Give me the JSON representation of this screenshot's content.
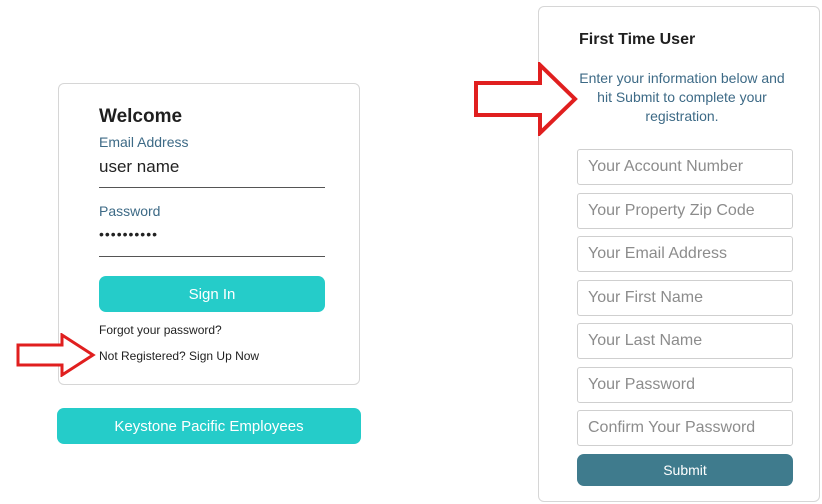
{
  "login": {
    "welcome": "Welcome",
    "email_label": "Email Address",
    "email_value": "user name",
    "password_label": "Password",
    "password_value": "••••••••••",
    "sign_in_label": "Sign In",
    "forgot_link": "Forgot your password?",
    "register_link": "Not Registered? Sign Up Now"
  },
  "employees_button": "Keystone Pacific Employees",
  "registration": {
    "title": "First Time User",
    "intro": "Enter your information below and hit Submit to complete your registration.",
    "fields": {
      "account_number": "Your Account Number",
      "zip_code": "Your Property Zip Code",
      "email": "Your Email Address",
      "first_name": "Your First Name",
      "last_name": "Your Last Name",
      "password": "Your Password",
      "confirm_password": "Confirm Your Password"
    },
    "submit_label": "Submit"
  },
  "annotations": {
    "arrow_color": "#e01f1f",
    "arrow_icon": "right-arrow-outline"
  }
}
